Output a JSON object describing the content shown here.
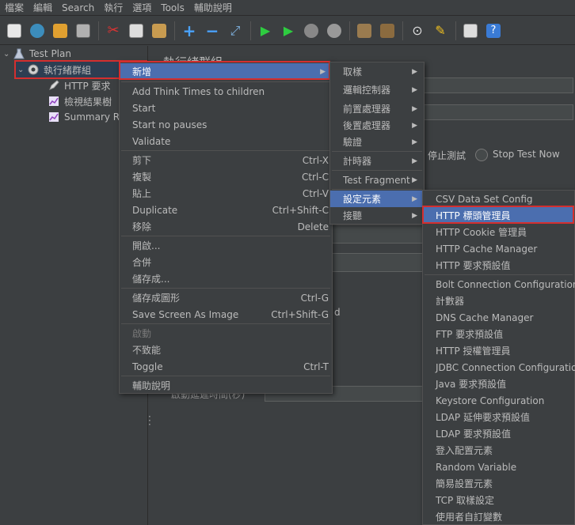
{
  "menubar": [
    "檔案",
    "編輯",
    "Search",
    "執行",
    "選項",
    "Tools",
    "輔助說明"
  ],
  "tree": {
    "root": "Test Plan",
    "group": "執行緒群組",
    "children": [
      "HTTP 要求",
      "檢視結果樹",
      "Summary Re"
    ]
  },
  "right_pane": {
    "title_fragment": "執行緒群組",
    "stop_label": "停止測試",
    "stop_now_label": "Stop Test Now",
    "field_label_fragment": "啟動延遲時間(秒)",
    "fragment_d": "d"
  },
  "context_menu": {
    "items": [
      {
        "label": "新增",
        "submenu": true
      },
      {
        "label": "Add Think Times to children"
      },
      {
        "label": "Start"
      },
      {
        "label": "Start no pauses"
      },
      {
        "label": "Validate"
      },
      {
        "label": "剪下",
        "shortcut": "Ctrl-X"
      },
      {
        "label": "複製",
        "shortcut": "Ctrl-C"
      },
      {
        "label": "貼上",
        "shortcut": "Ctrl-V"
      },
      {
        "label": "Duplicate",
        "shortcut": "Ctrl+Shift-C"
      },
      {
        "label": "移除",
        "shortcut": "Delete"
      },
      {
        "label": "開啟..."
      },
      {
        "label": "合併"
      },
      {
        "label": "儲存成..."
      },
      {
        "label": "儲存成圖形",
        "shortcut": "Ctrl-G"
      },
      {
        "label": "Save Screen As Image",
        "shortcut": "Ctrl+Shift-G"
      },
      {
        "label": "啟動",
        "disabled": true
      },
      {
        "label": "不致能"
      },
      {
        "label": "Toggle",
        "shortcut": "Ctrl-T"
      },
      {
        "label": "輔助說明"
      }
    ]
  },
  "add_submenu": {
    "items": [
      {
        "label": "取樣"
      },
      {
        "label": "邏輯控制器"
      },
      {
        "label": "前置處理器"
      },
      {
        "label": "後置處理器"
      },
      {
        "label": "驗證"
      },
      {
        "label": "計時器"
      },
      {
        "label": "Test Fragment"
      },
      {
        "label": "設定元素"
      },
      {
        "label": "接聽"
      }
    ]
  },
  "config_submenu": {
    "items": [
      "CSV Data Set Config",
      "HTTP 標頭管理員",
      "HTTP Cookie 管理員",
      "HTTP Cache Manager",
      "HTTP 要求預設值",
      "Bolt Connection Configuration",
      "計數器",
      "DNS Cache Manager",
      "FTP 要求預設值",
      "HTTP 授權管理員",
      "JDBC Connection Configuration",
      "Java 要求預設值",
      "Keystore Configuration",
      "LDAP 延伸要求預設值",
      "LDAP 要求預設值",
      "登入配置元素",
      "Random Variable",
      "簡易設置元素",
      "TCP 取樣設定",
      "使用者自訂變數"
    ]
  },
  "colors": {
    "highlight": "#4b6eaf",
    "annotation_red": "#d32f2f",
    "background": "#3c3f41"
  }
}
